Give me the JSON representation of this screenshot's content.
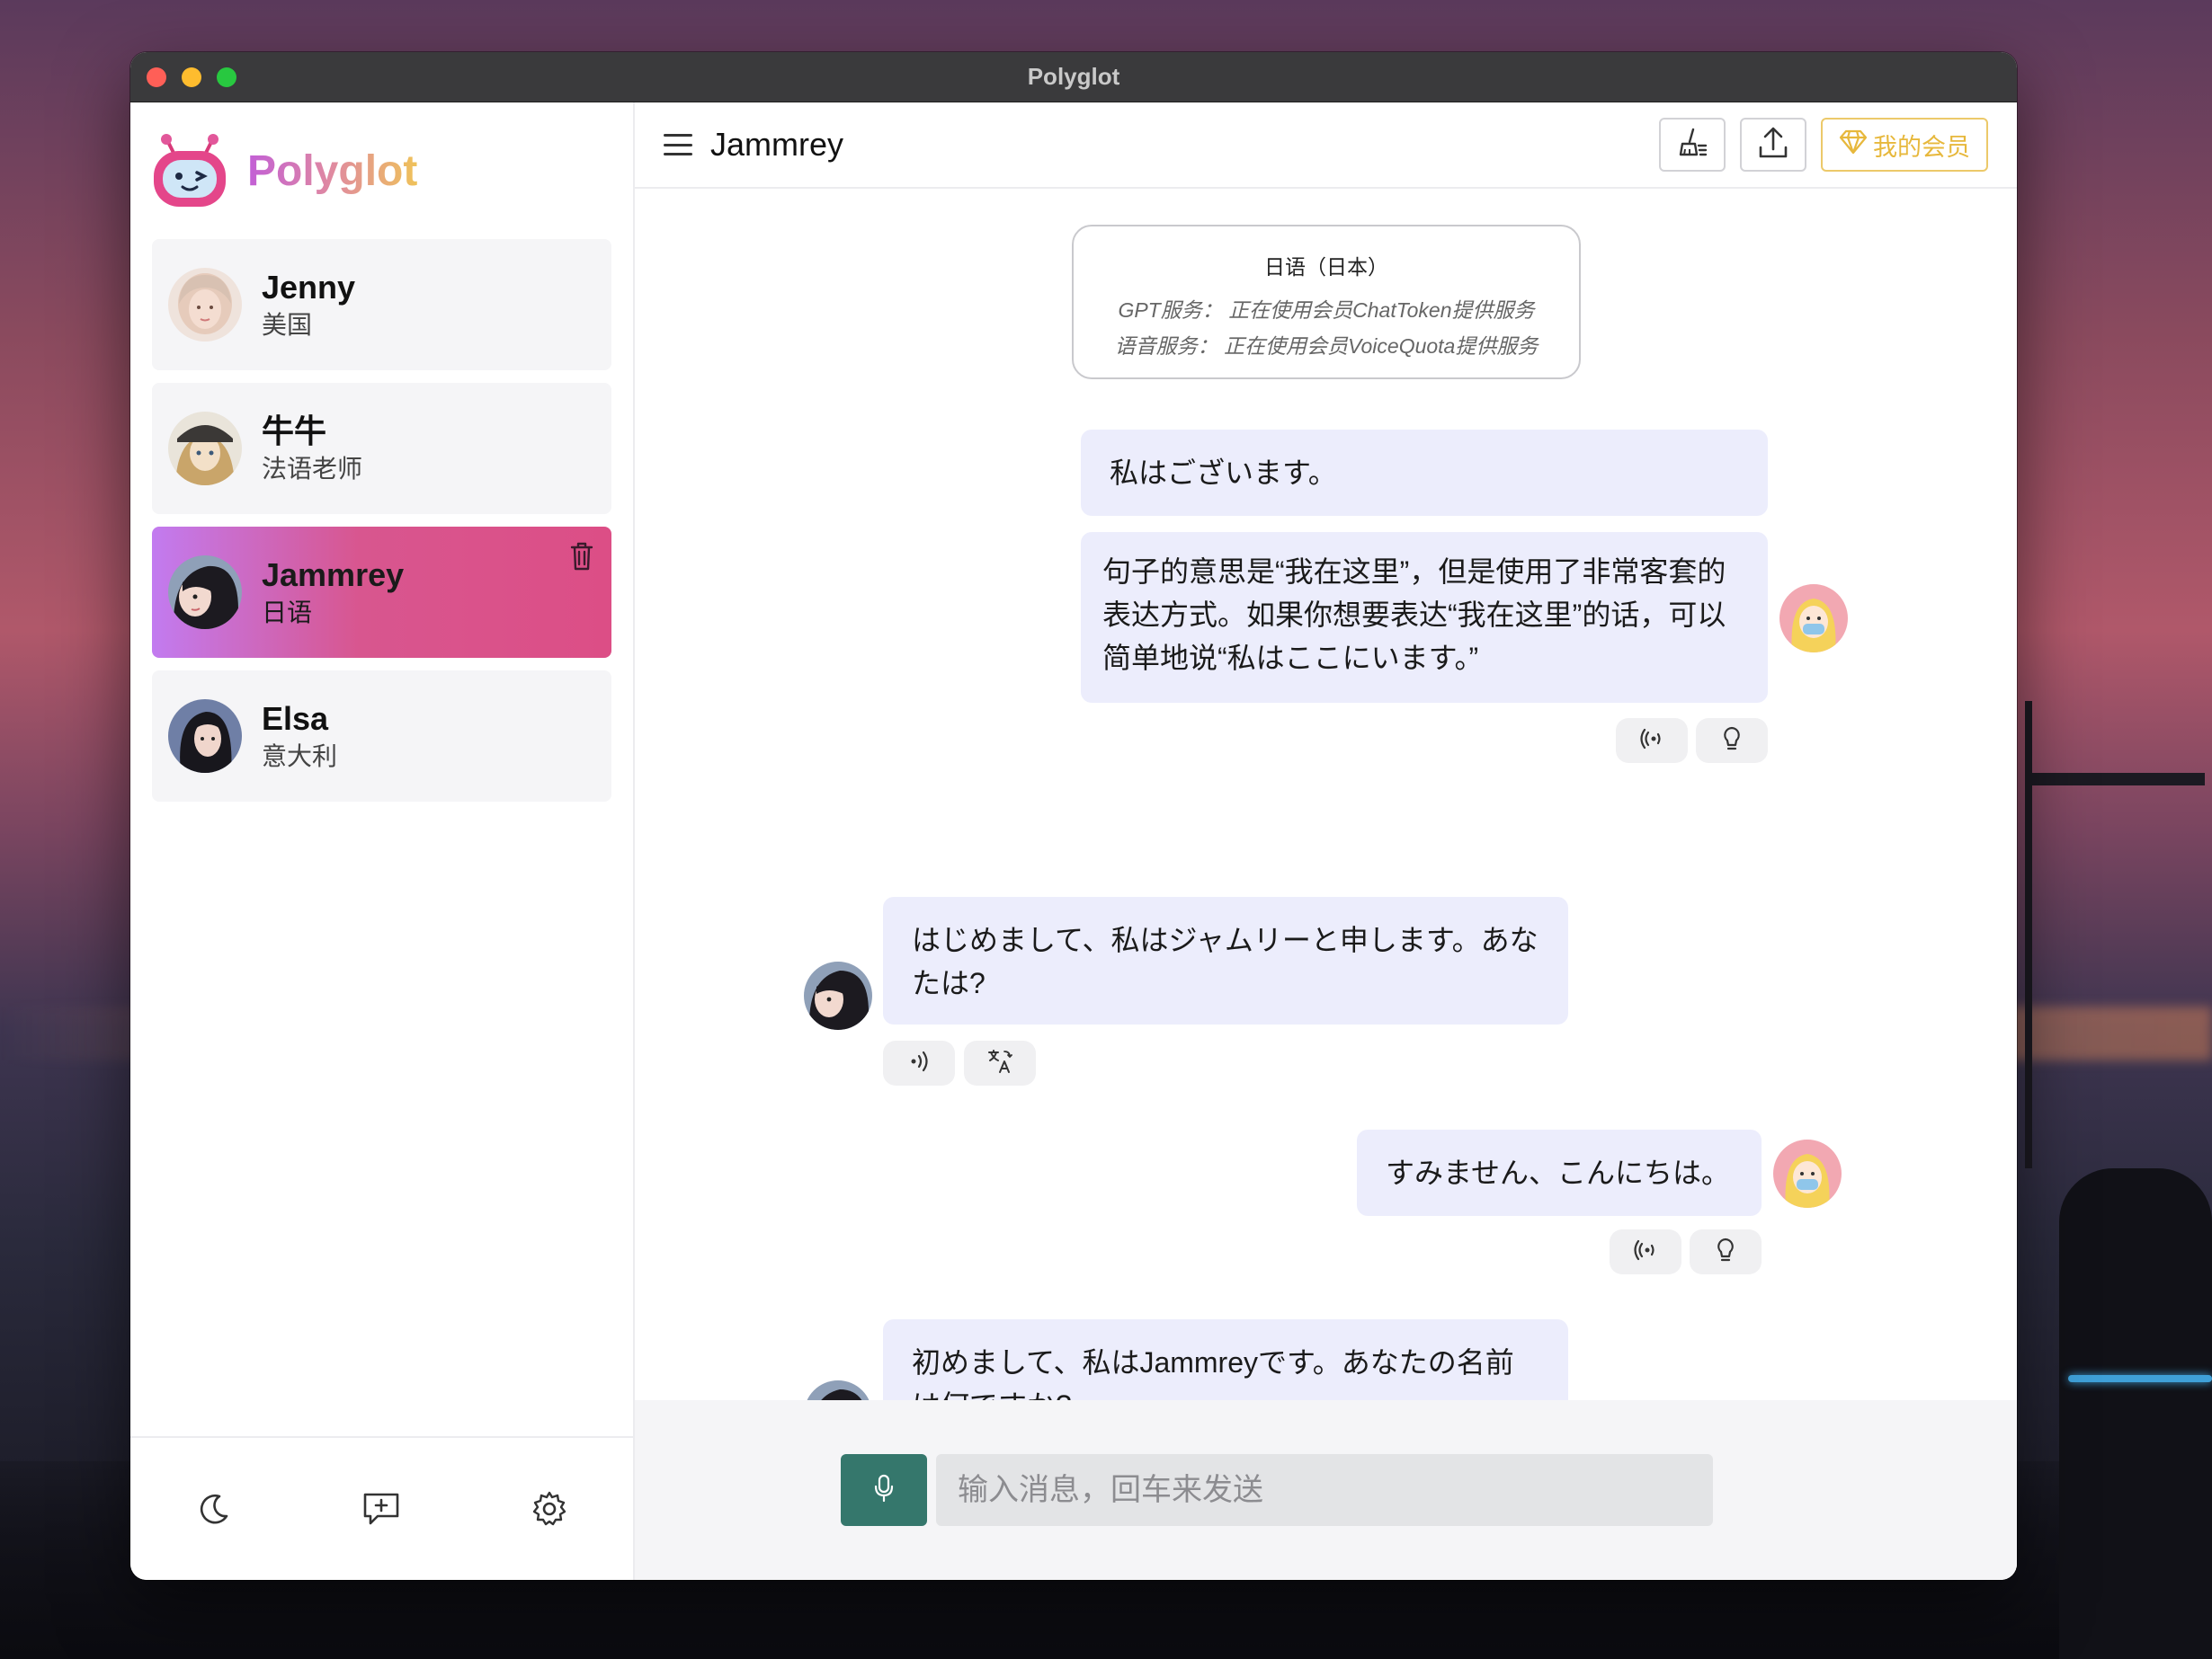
{
  "window": {
    "title": "Polyglot"
  },
  "brand": {
    "name": "Polyglot"
  },
  "contacts": [
    {
      "name": "Jenny",
      "language": "美国",
      "active": false
    },
    {
      "name": "牛牛",
      "language": "法语老师",
      "active": false
    },
    {
      "name": "Jammrey",
      "language": "日语",
      "active": true
    },
    {
      "name": "Elsa",
      "language": "意大利",
      "active": false
    }
  ],
  "header": {
    "title": "Jammrey",
    "vip_label": "我的会员",
    "icons": {
      "clear": "broom-icon",
      "export": "upload-icon",
      "vip": "diamond-icon"
    }
  },
  "info_card": {
    "title": "日语（日本）",
    "gpt_line": "GPT服务：  正在使用会员ChatToken提供服务",
    "voice_line": "语音服务：  正在使用会员VoiceQuota提供服务"
  },
  "messages": [
    {
      "role": "user",
      "text": "私はございます。"
    },
    {
      "role": "user",
      "text": "句子的意思是“我在这里”，但是使用了非常客套的表达方式。如果你想要表达“我在这里”的话，可以简单地说“私はここにいます。”"
    },
    {
      "role": "bot",
      "text": "はじめまして、私はジャムリーと申します。あなたは?"
    },
    {
      "role": "user",
      "text": "すみません、こんにちは。"
    },
    {
      "role": "bot",
      "text": "初めまして、私はJammreyです。あなたの名前は何ですか?"
    }
  ],
  "composer": {
    "placeholder": "输入消息，回车来发送"
  },
  "footer_icons": [
    "moon-icon",
    "new-chat-icon",
    "gear-icon"
  ],
  "colors": {
    "accent": "#35776c",
    "bubble": "#ecedfc",
    "active_start": "#c27bf0",
    "active_end": "#dc4e86",
    "vip": "#e7b83c"
  }
}
